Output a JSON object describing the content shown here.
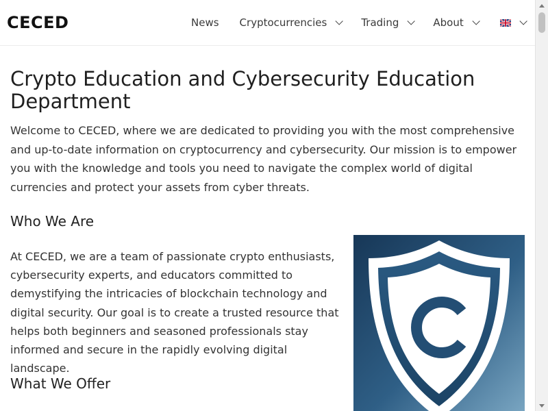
{
  "site": {
    "logo": "CECED"
  },
  "nav": {
    "items": [
      {
        "label": "News",
        "has_dropdown": false
      },
      {
        "label": "Cryptocurrencies",
        "has_dropdown": true
      },
      {
        "label": "Trading",
        "has_dropdown": true
      },
      {
        "label": "About",
        "has_dropdown": true
      }
    ],
    "language_icon": "uk-flag-icon"
  },
  "main": {
    "title": "Crypto Education and Cybersecurity Education Department",
    "intro": "Welcome to CECED, where we are dedicated to providing you with the most comprehensive and up-to-date information on cryptocurrency and cybersecurity. Our mission is to empower you with the knowledge and tools you need to navigate the complex world of digital currencies and protect your assets from cyber threats.",
    "who_heading": "Who We Are",
    "who_text": "At CECED, we are a team of passionate crypto enthusiasts, cybersecurity experts, and educators committed to demystifying the intricacies of blockchain technology and digital security. Our goal is to create a trusted resource that helps both beginners and seasoned professionals stay informed and secure in the rapidly evolving digital landscape.",
    "offer_heading": "What We Offer",
    "image_icon": "shield-c-logo-icon"
  },
  "colors": {
    "shield_bg_top": "#1a3a5c",
    "shield_bg_bottom": "#5e8fae",
    "shield_fill": "#ffffff",
    "shield_inner": "#224e73"
  }
}
